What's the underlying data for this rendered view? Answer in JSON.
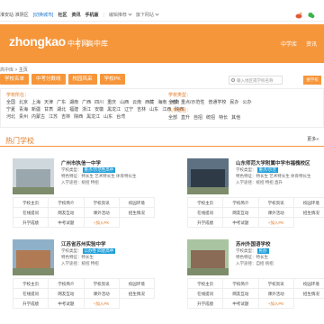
{
  "topbar": {
    "city": "淮安站·淮阴区",
    "switch": "[切换城市]",
    "nav": [
      "社区",
      "资讯",
      "手机版"
    ],
    "more1": "编辑推荐",
    "more2": "旗下网站"
  },
  "header": {
    "logo_en": "zhongkao",
    "logo_cn": "中考网",
    "channel": "高中库",
    "nav": [
      "中学库",
      "资讯"
    ]
  },
  "breadcrumb": {
    "home": "高中库",
    "sep": " > ",
    "current": "主页"
  },
  "tabs": [
    "学校名单",
    "中考分数线",
    "校园风采",
    "学校PK"
  ],
  "search": {
    "placeholder": "输入地区或学校名称",
    "button": "搜学校"
  },
  "filters": {
    "region_label": "学校所在：",
    "regions_row1": [
      "全国",
      "北京",
      "上海",
      "天津",
      "广东",
      "湖南",
      "广西",
      "四川",
      "重庆",
      "山西",
      "云南",
      "西藏",
      "海南",
      "河南"
    ],
    "regions_row2": [
      "宁夏",
      "青海",
      "新疆",
      "甘肃",
      "湖北",
      "福建",
      "浙江",
      "安徽",
      "黑龙江",
      "辽宁",
      "吉林",
      "山东",
      "江西",
      "陕西"
    ],
    "regions_row3": [
      "河北",
      "贵州",
      "内蒙古",
      "江苏",
      "吉林",
      "陕西",
      "黑龙江",
      "山东",
      "台湾"
    ],
    "type_label": "学校类型：",
    "types": [
      "全部",
      "重点/示范性",
      "普通学校",
      "民办",
      "公办"
    ],
    "method_label": "入学途径：",
    "methods": [
      "全部",
      "直升",
      "自招",
      "统招",
      "特长",
      "其他"
    ]
  },
  "section": {
    "title": "热门学校",
    "more": "更多»"
  },
  "schools": [
    {
      "name": "广州市执信一中学",
      "type_label": "学校类型：",
      "badge": "重点/示范性高中",
      "feature": "特色特征：特长生 艺术特长生 体育特长生",
      "method": "入学途径：统招 特招",
      "links": [
        "学校主页",
        "学校简介",
        "学校资讯",
        "校园环境",
        "在线提问",
        "网友互动",
        "课外活动",
        "招生情况",
        "升学成绩",
        "中考试题",
        "+加入PK"
      ]
    },
    {
      "name": "山东师范大学附属中学市福槐校区",
      "type_label": "学校类型：",
      "badge": "重点/示范",
      "feature": "特色特征：特长生 艺术特长生 体育特长生",
      "method": "入学途径：统招 特招 直升",
      "links": [
        "学校主页",
        "学校简介",
        "学校资讯",
        "校园环境",
        "在线提问",
        "网友互动",
        "课外活动",
        "招生情况",
        "升学成绩",
        "中考试题",
        "+加入PK"
      ]
    },
    {
      "name": "江苏省苏州实验中学",
      "type_label": "学校类型：",
      "badge": "公办性 四星高中",
      "feature": "特色特征：特长生",
      "method": "入学途径：统招 特招",
      "links": [
        "学校主页",
        "学校简介",
        "学校资讯",
        "校园环境",
        "在线提问",
        "网友互动",
        "课外活动",
        "招生情况",
        "升学成绩",
        "中考试题",
        "+加入PK"
      ]
    },
    {
      "name": "苏州外国语学校",
      "type_label": "学校类型：",
      "badge": "民办",
      "feature": "特色特征：特长生",
      "method": "入学途径：自招 统招",
      "links": [
        "学校主页",
        "学校简介",
        "学校资讯",
        "校园环境",
        "在线提问",
        "网友互动",
        "课外活动",
        "招生情况",
        "升学成绩",
        "中考试题",
        "+加入PK"
      ]
    }
  ]
}
